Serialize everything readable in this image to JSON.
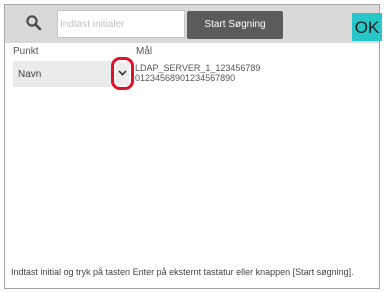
{
  "search": {
    "placeholder": "Indtast initialer",
    "value": ""
  },
  "toolbar": {
    "start_label": "Start Søgning",
    "ok_label": "OK"
  },
  "columns": {
    "punkt": "Punkt",
    "maal": "Mål"
  },
  "dropdown": {
    "selected": "Navn"
  },
  "target": {
    "line1": "LDAP_SERVER_1_123456789",
    "line2": "01234568901234567890"
  },
  "hint": "Indtast initial og tryk på tasten Enter på eksternt tastatur eller knappen [Start søgning].",
  "colors": {
    "ok_button": "#27c7c9",
    "start_button": "#5b5b5b",
    "highlight": "#e0102a",
    "topbar": "#d9d9d9"
  },
  "icons": {
    "search": "search-icon",
    "dropdown": "chevron-down-icon"
  }
}
